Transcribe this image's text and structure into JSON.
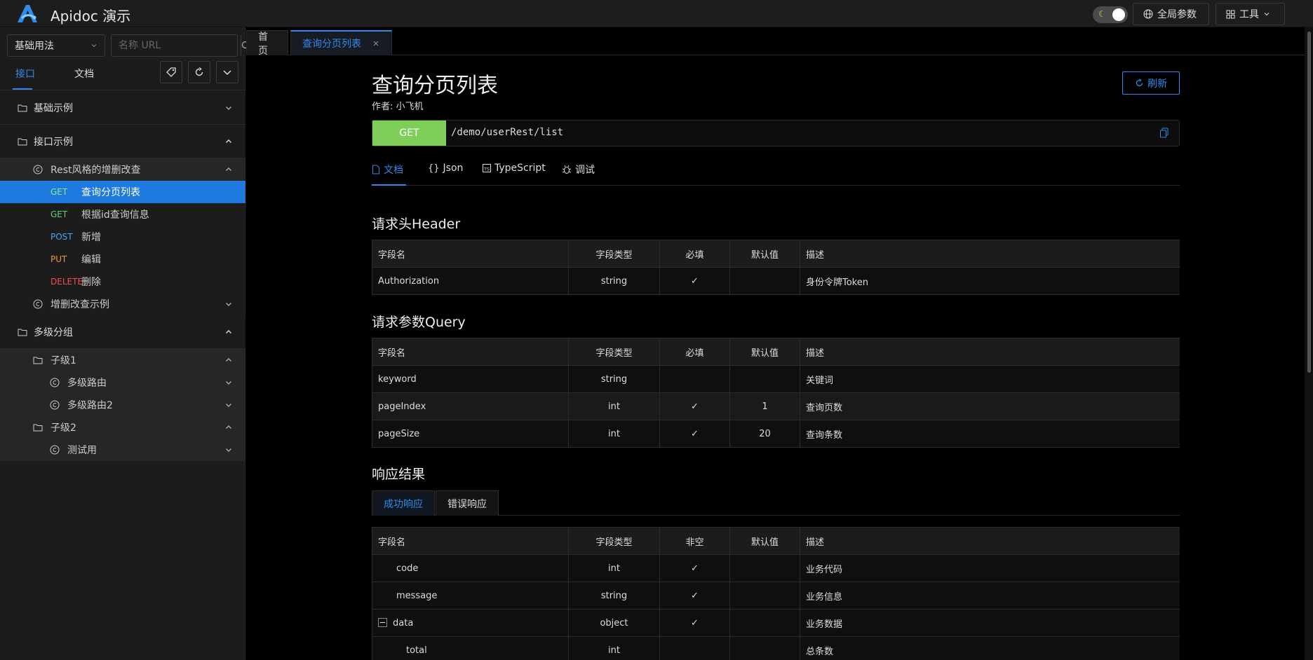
{
  "app": {
    "title": "Apidoc 演示"
  },
  "header": {
    "global_params_label": "全局参数",
    "tools_label": "工具"
  },
  "sidebar": {
    "mode_select": "基础用法",
    "search_placeholder": "名称 URL",
    "tabs": [
      {
        "label": "接口",
        "active": true
      },
      {
        "label": "文档",
        "active": false
      }
    ],
    "tree": {
      "group_basic": "基础示例",
      "group_api": "接口示例",
      "rest_group": "Rest风格的增删改查",
      "endpoints": [
        {
          "method": "GET",
          "label": "查询分页列表",
          "active": true
        },
        {
          "method": "GET",
          "label": "根据id查询信息"
        },
        {
          "method": "POST",
          "label": "新增"
        },
        {
          "method": "PUT",
          "label": "编辑"
        },
        {
          "method": "DELETE",
          "label": "删除"
        }
      ],
      "crud_example": "增删改查示例",
      "group_multi": "多级分组",
      "child1": "子级1",
      "multi_route": "多级路由",
      "multi_route2": "多级路由2",
      "child2": "子级2",
      "test": "测试用"
    }
  },
  "tabs": {
    "home": "首页",
    "current": "查询分页列表"
  },
  "page": {
    "title": "查询分页列表",
    "author": "作者: 小飞机",
    "refresh": "刷新",
    "method": "GET",
    "path": "/demo/userRest/list",
    "doc_tabs": [
      "文档",
      "Json",
      "TypeScript",
      "调试"
    ]
  },
  "header_section": {
    "title": "请求头Header",
    "columns": [
      "字段名",
      "字段类型",
      "必填",
      "默认值",
      "描述"
    ],
    "rows": [
      {
        "name": "Authorization",
        "type": "string",
        "required": "✓",
        "default": "",
        "desc": "身份令牌Token"
      }
    ]
  },
  "query_section": {
    "title": "请求参数Query",
    "columns": [
      "字段名",
      "字段类型",
      "必填",
      "默认值",
      "描述"
    ],
    "rows": [
      {
        "name": "keyword",
        "type": "string",
        "required": "",
        "default": "",
        "desc": "关键词"
      },
      {
        "name": "pageIndex",
        "type": "int",
        "required": "✓",
        "default": "1",
        "desc": "查询页数"
      },
      {
        "name": "pageSize",
        "type": "int",
        "required": "✓",
        "default": "20",
        "desc": "查询条数"
      }
    ]
  },
  "response_section": {
    "title": "响应结果",
    "tabs": [
      "成功响应",
      "错误响应"
    ],
    "columns": [
      "字段名",
      "字段类型",
      "非空",
      "默认值",
      "描述"
    ],
    "rows": [
      {
        "name": "code",
        "type": "int",
        "required": "✓",
        "default": "",
        "desc": "业务代码"
      },
      {
        "name": "message",
        "type": "string",
        "required": "✓",
        "default": "",
        "desc": "业务信息"
      },
      {
        "name": "data",
        "type": "object",
        "required": "✓",
        "default": "",
        "desc": "业务数据"
      },
      {
        "name": "total",
        "type": "int",
        "required": "",
        "default": "",
        "desc": "总条数"
      }
    ]
  },
  "colors": {
    "accent": "#2f8ceb",
    "get_button": "#7fce59",
    "method_get": "#5dd46a",
    "method_post": "#4ba6ef",
    "method_put": "#e89a3c",
    "method_delete": "#ef4f4f"
  }
}
